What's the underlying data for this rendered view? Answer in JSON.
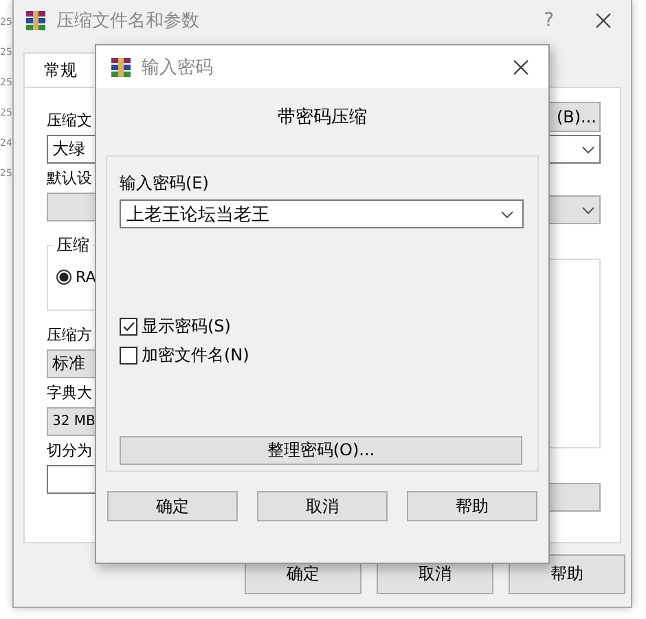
{
  "behind_text": [
    "25",
    "25",
    "25",
    "25",
    "24",
    "25"
  ],
  "window": {
    "title": "压缩文件名和参数",
    "help": "?"
  },
  "tabs": [
    {
      "label": "常规",
      "selected": true
    }
  ],
  "general": {
    "archive_name_label": "压缩文",
    "archive_name_value": "大绿",
    "browse_button": "(B)...",
    "profile_label": "默认设",
    "format_group": {
      "title": "压缩",
      "option": {
        "label": "RA",
        "selected": true
      }
    },
    "method_label": "压缩方",
    "method_value": "标准",
    "dictionary_label": "字典大",
    "dictionary_value": "32 MB",
    "split_label": "切分为"
  },
  "buttons": [
    "确定",
    "取消",
    "帮助"
  ],
  "password_dialog": {
    "title": "输入密码",
    "heading": "带密码压缩",
    "password_label": "输入密码(E)",
    "password_value": "上老王论坛当老王",
    "options": [
      {
        "label": "显示密码(S)",
        "checked": true
      },
      {
        "label": "加密文件名(N)",
        "checked": false
      }
    ],
    "organize_button": "整理密码(O)...",
    "buttons": [
      "确定",
      "取消",
      "帮助"
    ]
  }
}
